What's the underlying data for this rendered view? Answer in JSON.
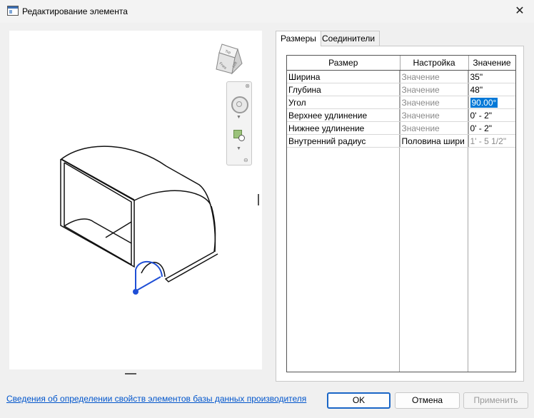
{
  "window": {
    "title": "Редактирование элемента",
    "close_glyph": "✕"
  },
  "viewcube": {
    "faces": [
      "Front",
      "Left",
      "Top"
    ]
  },
  "tabs": [
    {
      "label": "Размеры",
      "active": true
    },
    {
      "label": "Соединители",
      "active": false
    }
  ],
  "grid": {
    "headers": [
      "Размер",
      "Настройка",
      "Значение"
    ],
    "rows": [
      {
        "size": "Ширина",
        "setting": "Значение",
        "value": "35\""
      },
      {
        "size": "Глубина",
        "setting": "Значение",
        "value": "48\""
      },
      {
        "size": "Угол",
        "setting": "Значение",
        "value": "90.00°",
        "selected": true
      },
      {
        "size": "Верхнее удлинение",
        "setting": "Значение",
        "value": "0' - 2\""
      },
      {
        "size": "Нижнее удлинение",
        "setting": "Значение",
        "value": "0' - 2\""
      },
      {
        "size": "Внутренний радиус",
        "setting": "Половина шири",
        "value": "1' - 5 1/2\"",
        "setting_active": true,
        "value_dim": true
      }
    ]
  },
  "footer": {
    "link": "Сведения об определении свойств элементов базы данных производителя",
    "ok": "OK",
    "cancel": "Отмена",
    "apply": "Применить"
  },
  "colors": {
    "accent": "#0078d7",
    "highlight": "#1f4fd6",
    "link": "#0055cc"
  }
}
